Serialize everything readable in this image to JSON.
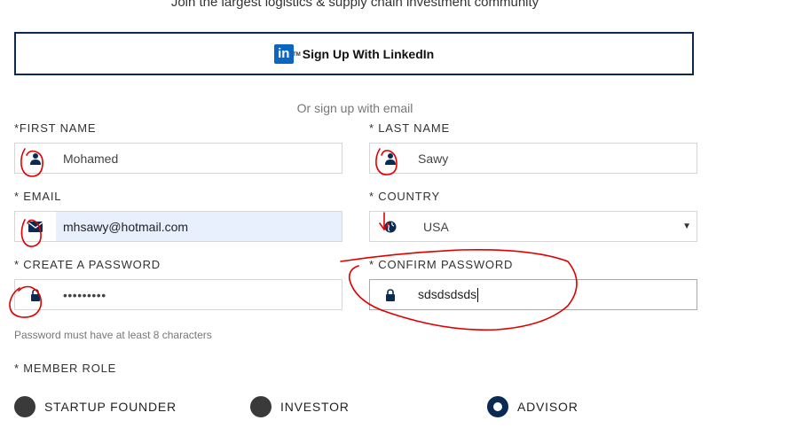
{
  "header": {
    "tagline": "Join the largest logistics & supply chain investment community"
  },
  "linkedin": {
    "label": "Sign Up With LinkedIn",
    "logo_text": "in",
    "tm": "TM"
  },
  "divider": {
    "text": "Or sign up with email"
  },
  "form": {
    "first_name": {
      "label": "*FIRST NAME",
      "value": "Mohamed"
    },
    "last_name": {
      "label": "* LAST NAME",
      "value": "Sawy"
    },
    "email": {
      "label": "* EMAIL",
      "value": "mhsawy@hotmail.com"
    },
    "country": {
      "label": "* COUNTRY",
      "value": "USA",
      "arrow": "▼"
    },
    "create_password": {
      "label": "* CREATE A PASSWORD",
      "value": "•••••••••"
    },
    "confirm_password": {
      "label": "* CONFIRM PASSWORD",
      "value": "sdsdsdsds"
    },
    "password_hint": "Password must have at least 8 characters"
  },
  "member_role": {
    "label": "* MEMBER ROLE",
    "options": [
      {
        "label": "STARTUP FOUNDER",
        "selected": false
      },
      {
        "label": "INVESTOR",
        "selected": false
      },
      {
        "label": "ADVISOR",
        "selected": true
      }
    ]
  },
  "colors": {
    "navy": "#0b2a52",
    "linkedin": "#0a66c2",
    "annotation": "#e00000",
    "autofill": "#e8f0fe"
  }
}
